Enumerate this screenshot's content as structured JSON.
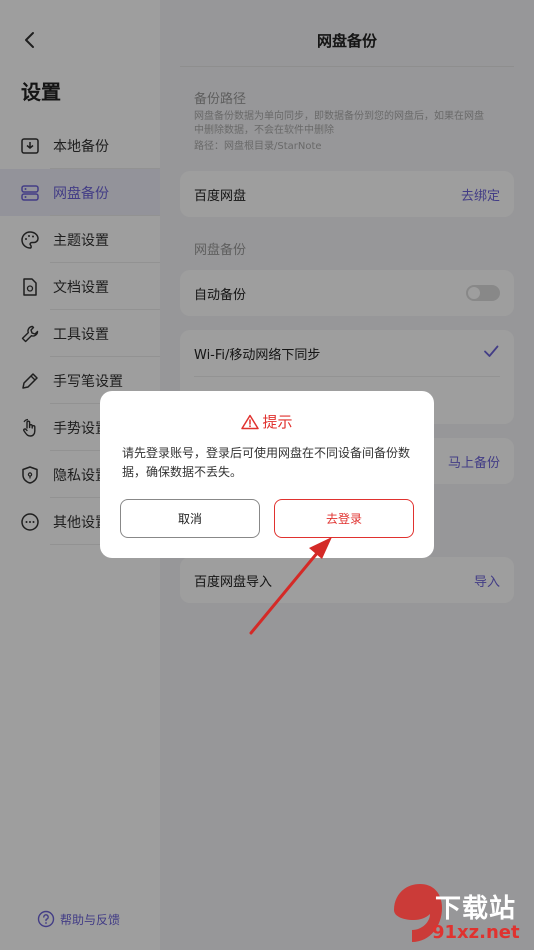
{
  "sidebar": {
    "title": "设置",
    "items": [
      {
        "label": "本地备份",
        "icon": "local-backup-icon",
        "active": false
      },
      {
        "label": "网盘备份",
        "icon": "cloud-backup-icon",
        "active": true
      },
      {
        "label": "主题设置",
        "icon": "palette-icon",
        "active": false
      },
      {
        "label": "文档设置",
        "icon": "document-settings-icon",
        "active": false
      },
      {
        "label": "工具设置",
        "icon": "wrench-icon",
        "active": false
      },
      {
        "label": "手写笔设置",
        "icon": "pen-icon",
        "active": false
      },
      {
        "label": "手势设置",
        "icon": "hand-gesture-icon",
        "active": false
      },
      {
        "label": "隐私设置",
        "icon": "shield-icon",
        "active": false
      },
      {
        "label": "其他设置",
        "icon": "more-icon",
        "active": false
      }
    ],
    "help_label": "帮助与反馈"
  },
  "main": {
    "title": "网盘备份",
    "path_section": "备份路径",
    "path_desc": "网盘备份数据为单向同步，即数据备份到您的网盘后，如果在网盘中删除数据，不会在软件中删除",
    "path_value": "路径：网盘根目录/StarNote",
    "baidu_label": "百度网盘",
    "unbind_link": "去绑定",
    "backup_section": "网盘备份",
    "auto_backup_label": "自动备份",
    "auto_backup_on": false,
    "wifi_sync_label": "Wi-Fi/移动网络下同步",
    "backup_now_link": "马上备份",
    "import_label": "百度网盘导入",
    "import_link": "导入"
  },
  "dialog": {
    "title": "提示",
    "message": "请先登录账号，登录后可使用网盘在不同设备间备份数据，确保数据不丢失。",
    "cancel_label": "取消",
    "login_label": "去登录"
  },
  "watermark": {
    "line1": "下载站",
    "line2": "91xz.net"
  },
  "colors": {
    "accent": "#6c63d9",
    "danger": "#e0322f",
    "overlay": "rgba(0,0,0,0.38)"
  }
}
